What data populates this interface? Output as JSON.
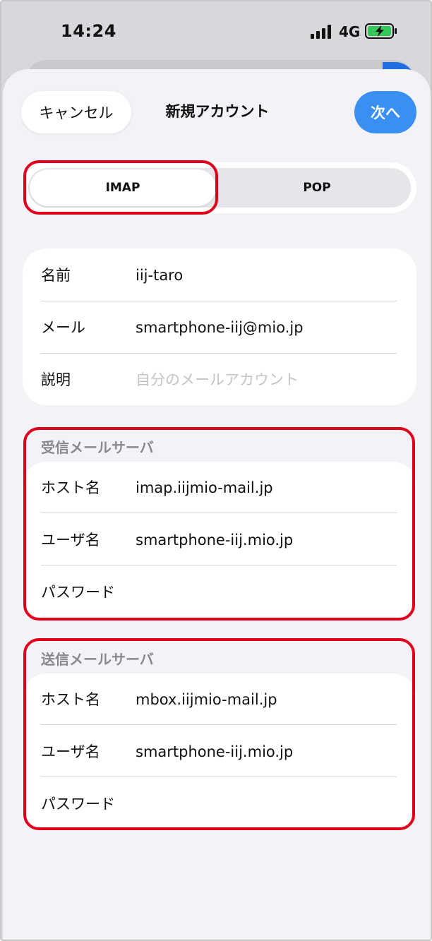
{
  "status": {
    "time": "14:24",
    "network": "4G"
  },
  "nav": {
    "cancel": "キャンセル",
    "title": "新規アカウント",
    "next": "次へ"
  },
  "segment": {
    "selected": "IMAP",
    "options": [
      "IMAP",
      "POP"
    ]
  },
  "account": {
    "name_label": "名前",
    "name_value": "iij-taro",
    "mail_label": "メール",
    "mail_value": "smartphone-iij@mio.jp",
    "desc_label": "説明",
    "desc_placeholder": "自分のメールアカウント"
  },
  "incoming": {
    "header": "受信メールサーバ",
    "host_label": "ホスト名",
    "host_value": "imap.iijmio-mail.jp",
    "user_label": "ユーザ名",
    "user_value": "smartphone-iij.mio.jp",
    "pass_label": "パスワード"
  },
  "outgoing": {
    "header": "送信メールサーバ",
    "host_label": "ホスト名",
    "host_value": "mbox.iijmio-mail.jp",
    "user_label": "ユーザ名",
    "user_value": "smartphone-iij.mio.jp",
    "pass_label": "パスワード"
  },
  "colors": {
    "accent": "#3a8ff2",
    "highlight": "#e0001b",
    "battery": "#34c759"
  }
}
